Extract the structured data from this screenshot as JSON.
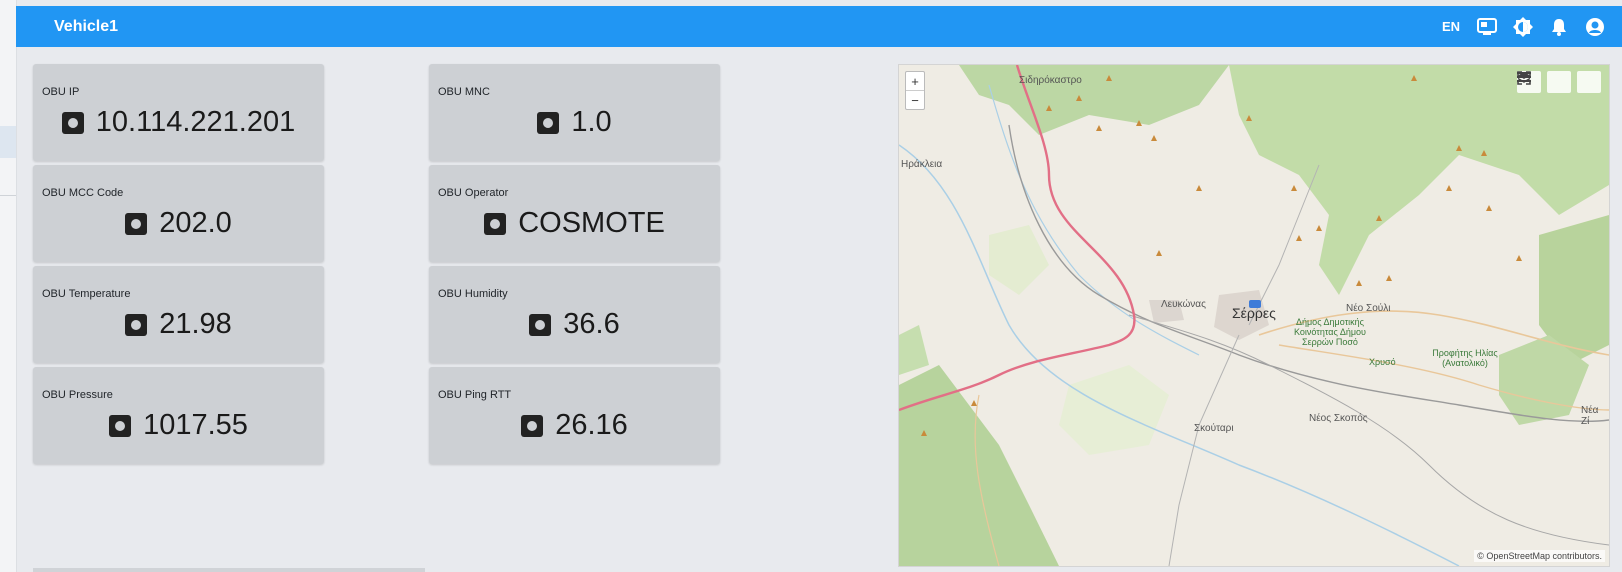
{
  "header": {
    "title": "Vehicle1",
    "lang": "EN"
  },
  "icons": [
    "display-icon",
    "brightness-icon",
    "bell-icon",
    "account-icon"
  ],
  "cards": [
    {
      "label": "OBU IP",
      "value": "10.114.221.201"
    },
    {
      "label": "OBU MNC",
      "value": "1.0"
    },
    {
      "label": "OBU MCC Code",
      "value": "202.0"
    },
    {
      "label": "OBU Operator",
      "value": "COSMOTE"
    },
    {
      "label": "OBU Temperature",
      "value": "21.98"
    },
    {
      "label": "OBU Humidity",
      "value": "36.6"
    },
    {
      "label": "OBU Pressure",
      "value": "1017.55"
    },
    {
      "label": "OBU Ping RTT",
      "value": "26.16"
    }
  ],
  "map": {
    "zoom_in": "+",
    "zoom_out": "−",
    "attribution": "© OpenStreetMap contributors.",
    "places": [
      "Σιδηρόκαστρο",
      "Ηράκλεια",
      "Λευκώνας",
      "Σέρρες",
      "Νέο Σούλι",
      "Σκούταρι",
      "Νέος Σκοπός",
      "Νέα Ζί",
      "Δήμος Δημοτικής Κοινότητας Δήμου Σερρών Ποσό",
      "Χρυσό",
      "Προφήτης Ηλίας (Ανατολικό)"
    ]
  }
}
